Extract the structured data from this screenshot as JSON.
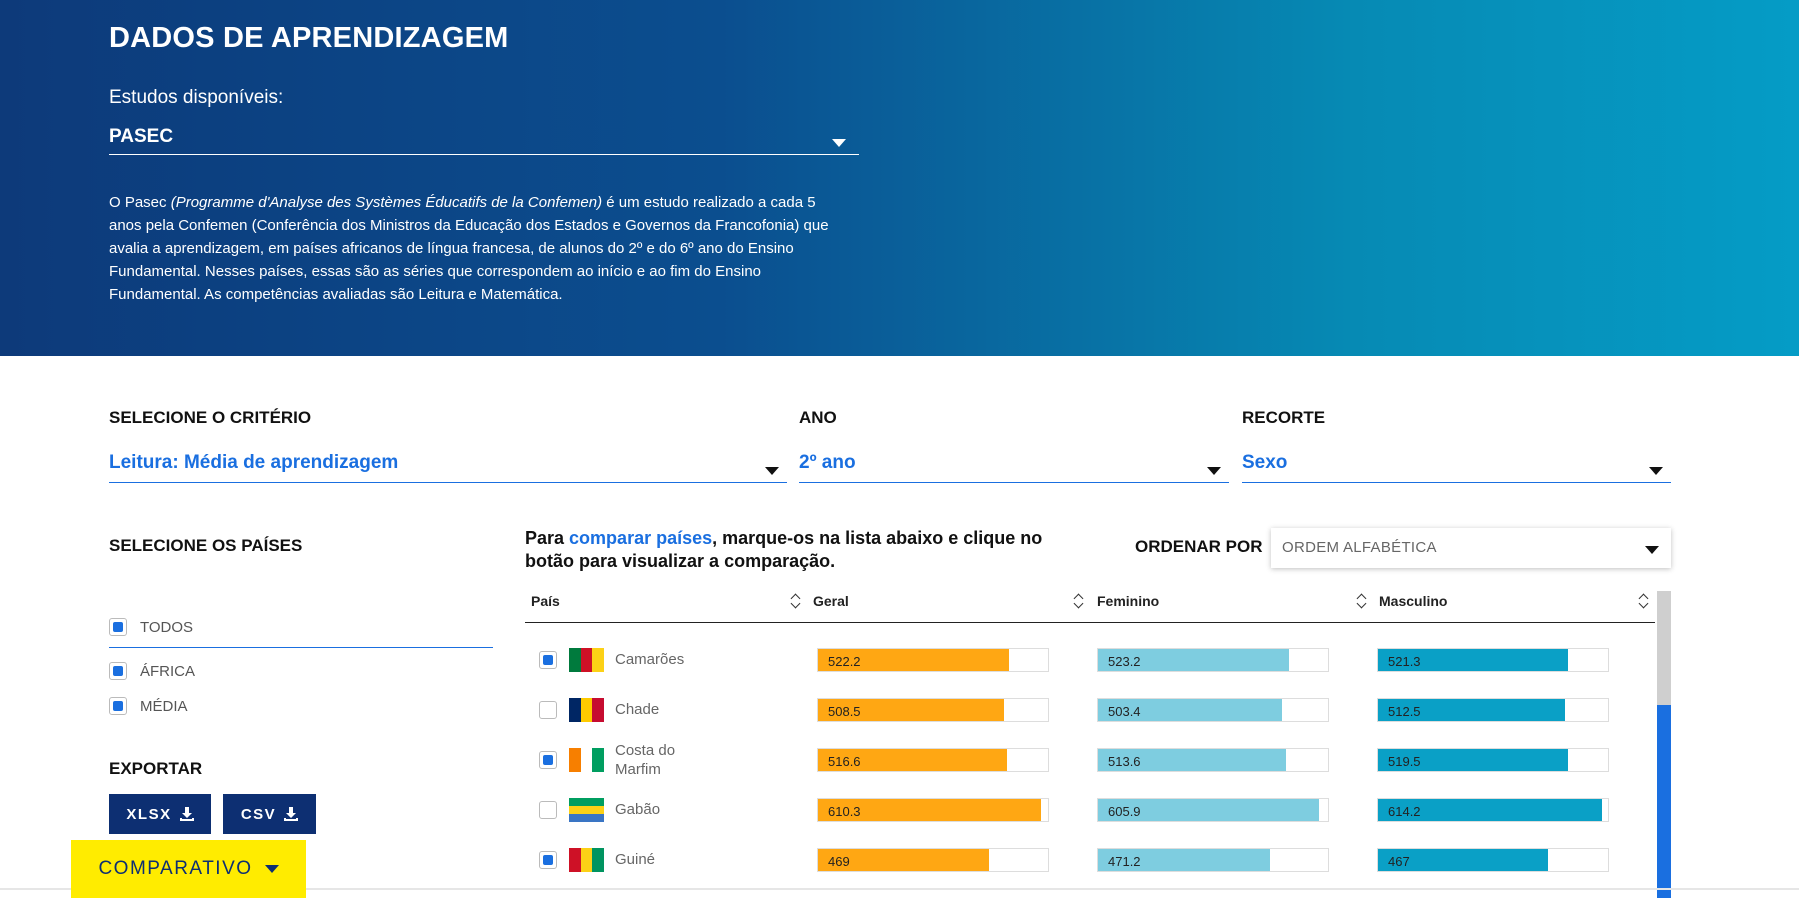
{
  "header": {
    "title": "DADOS DE APRENDIZAGEM",
    "studies_label": "Estudos disponíveis:",
    "study_selected": "PASEC",
    "description_prefix": "O Pasec ",
    "description_italic": "(Programme d'Analyse des Systèmes Éducatifs de la Confemen)",
    "description_rest": " é um estudo realizado a cada 5 anos pela Confemen (Conferência dos Ministros da Educação dos Estados e Governos da Francofonia) que avalia a aprendizagem, em países africanos de língua francesa, de alunos do 2º e do 6º ano do Ensino Fundamental. Nesses países, essas são as séries que correspondem ao início e ao fim do Ensino Fundamental. As competências avaliadas são Leitura e Matemática."
  },
  "filters": {
    "criterio_label": "SELECIONE O CRITÉRIO",
    "criterio_value": "Leitura: Média de aprendizagem",
    "ano_label": "ANO",
    "ano_value": "2º ano",
    "recorte_label": "RECORTE",
    "recorte_value": "Sexo"
  },
  "sidebar": {
    "countries_title": "SELECIONE OS PAÍSES",
    "options": [
      {
        "label": "TODOS",
        "checked": true
      },
      {
        "label": "ÁFRICA",
        "checked": true
      },
      {
        "label": "MÉDIA",
        "checked": true
      }
    ],
    "export_title": "EXPORTAR",
    "xlsx_label": "XLSX",
    "csv_label": "CSV",
    "download_icon": "download-icon"
  },
  "compare": {
    "intro_a": "Para ",
    "intro_link": "comparar países",
    "intro_b": ", marque-os na lista abaixo e clique no botão para visualizar a comparação.",
    "order_label": "ORDENAR POR",
    "order_value": "ORDEM ALFABÉTICA"
  },
  "table": {
    "headers": [
      "País",
      "Geral",
      "Feminino",
      "Masculino"
    ],
    "max_value": 630,
    "colors": {
      "geral": "#ffa713",
      "feminino": "#7ecde0",
      "masculino": "#0aa0c6"
    },
    "rows": [
      {
        "country": "Camarões",
        "checked": true,
        "flag": [
          "#007a3d",
          "#ce1126",
          "#fcd116"
        ],
        "flag_dir": "v",
        "geral": 522.2,
        "feminino": 523.2,
        "masculino": 521.3
      },
      {
        "country": "Chade",
        "checked": false,
        "flag": [
          "#002664",
          "#fecb00",
          "#c60c30"
        ],
        "flag_dir": "v",
        "geral": 508.5,
        "feminino": 503.4,
        "masculino": 512.5
      },
      {
        "country": "Costa do Marfim",
        "checked": true,
        "flag": [
          "#f77f00",
          "#ffffff",
          "#009e60"
        ],
        "flag_dir": "v",
        "geral": 516.6,
        "feminino": 513.6,
        "masculino": 519.5
      },
      {
        "country": "Gabão",
        "checked": false,
        "flag": [
          "#009e60",
          "#fcd116",
          "#3a75c4"
        ],
        "flag_dir": "h",
        "geral": 610.3,
        "feminino": 605.9,
        "masculino": 614.2
      },
      {
        "country": "Guiné",
        "checked": true,
        "flag": [
          "#ce1126",
          "#fcd116",
          "#009460"
        ],
        "flag_dir": "v",
        "geral": 469,
        "feminino": 471.2,
        "masculino": 467
      }
    ]
  },
  "footer": {
    "comparativo_label": "COMPARATIVO"
  }
}
